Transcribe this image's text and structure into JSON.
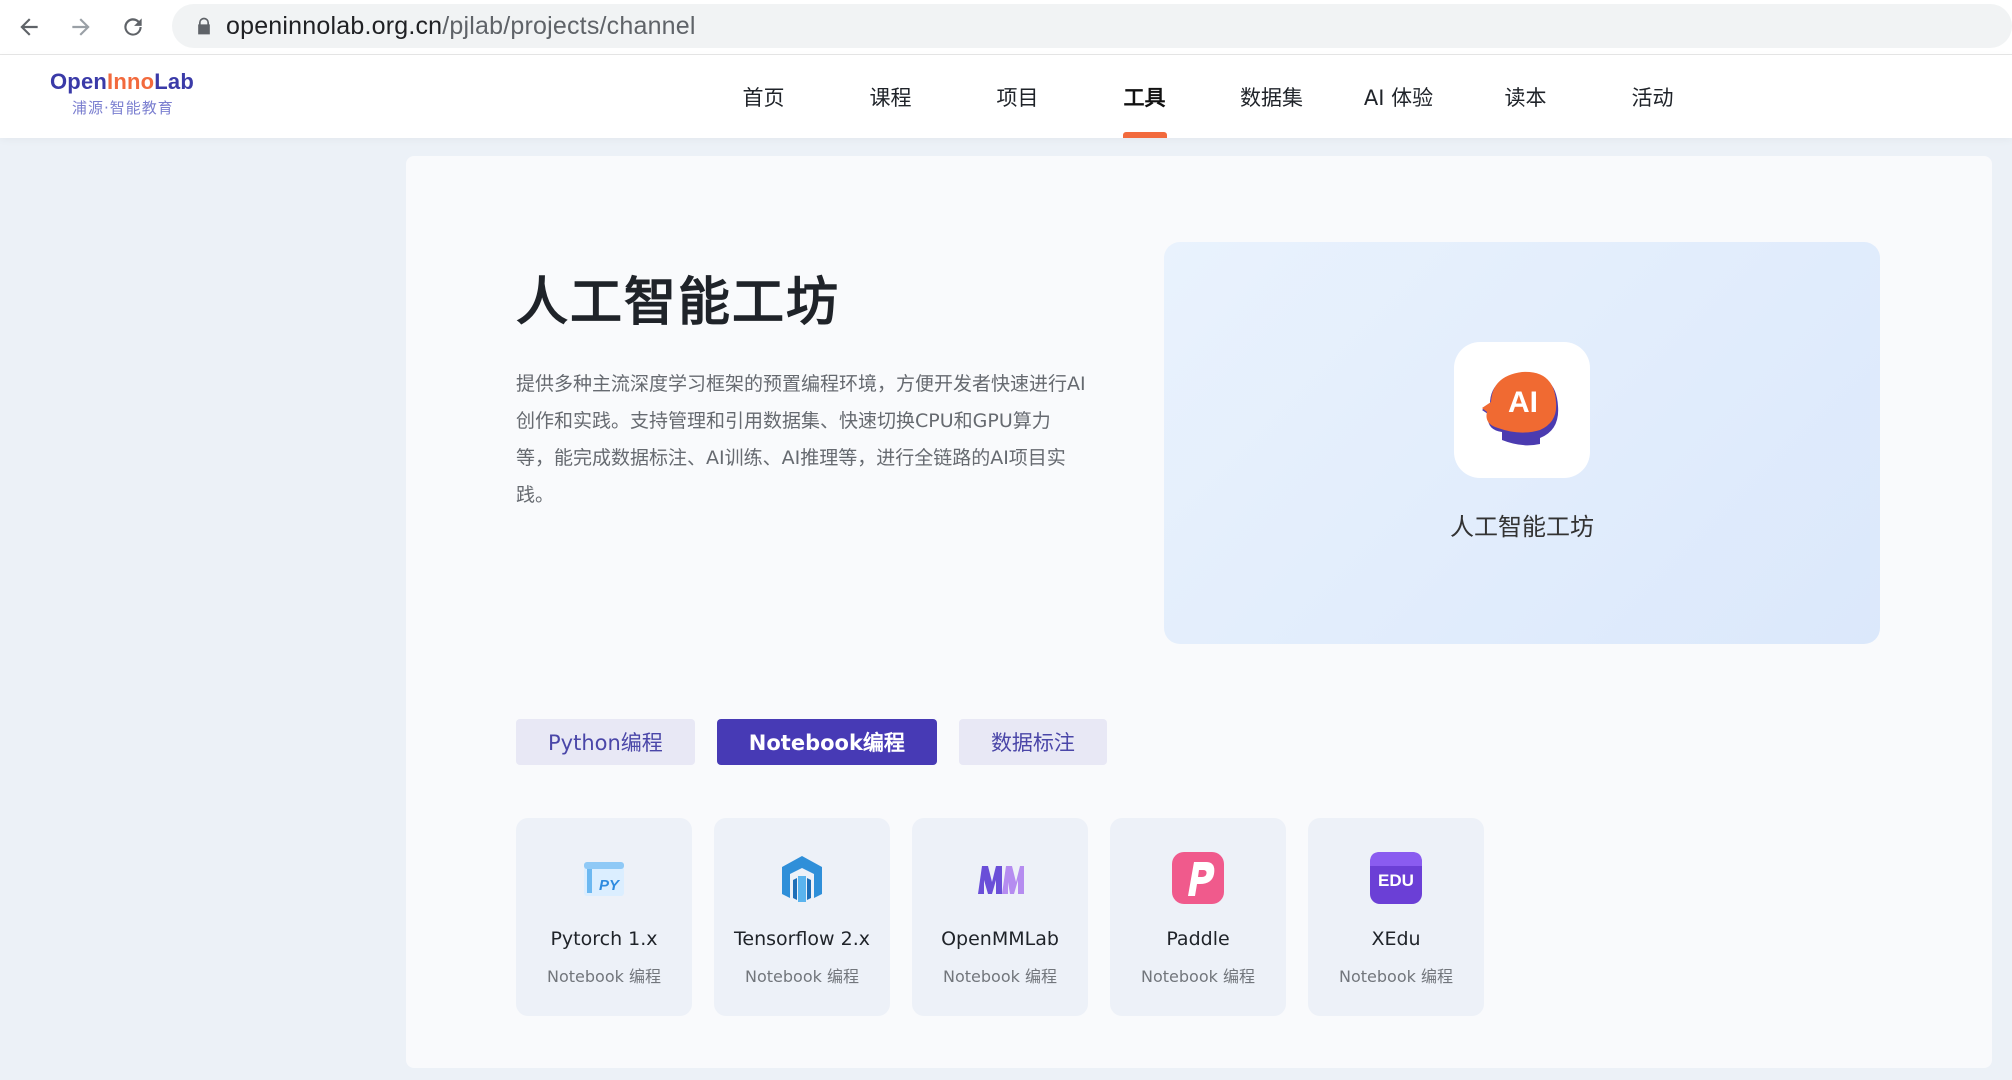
{
  "browser": {
    "url_host": "openinnolab.org.cn",
    "url_path": "/pjlab/projects/channel"
  },
  "header": {
    "logo_open": "Open",
    "logo_inno": "Inno",
    "logo_lab": "Lab",
    "logo_sub": "浦源·智能教育",
    "menu": [
      {
        "label": "首页"
      },
      {
        "label": "课程"
      },
      {
        "label": "项目"
      },
      {
        "label": "工具",
        "active": true
      },
      {
        "label": "数据集"
      },
      {
        "label": "AI 体验"
      },
      {
        "label": "读本"
      },
      {
        "label": "活动"
      }
    ]
  },
  "hero": {
    "title": "人工智能工坊",
    "description": "提供多种主流深度学习框架的预置编程环境，方便开发者快速进行AI创作和实践。支持管理和引用数据集、快速切换CPU和GPU算力等，能完成数据标注、AI训练、AI推理等，进行全链路的AI项目实践。",
    "card_label": "人工智能工坊",
    "card_icon_text": "AI"
  },
  "tabs": [
    {
      "label": "Python编程"
    },
    {
      "label": "Notebook编程",
      "active": true
    },
    {
      "label": "数据标注"
    }
  ],
  "tools": [
    {
      "name": "Pytorch 1.x",
      "sub": "Notebook 编程",
      "icon": "pytorch-icon"
    },
    {
      "name": "Tensorflow 2.x",
      "sub": "Notebook 编程",
      "icon": "tensorflow-icon"
    },
    {
      "name": "OpenMMLab",
      "sub": "Notebook 编程",
      "icon": "openmmlab-icon"
    },
    {
      "name": "Paddle",
      "sub": "Notebook 编程",
      "icon": "paddle-icon"
    },
    {
      "name": "XEdu",
      "sub": "Notebook 编程",
      "icon": "xedu-icon"
    }
  ],
  "colors": {
    "accent": "#f26a3d",
    "primary": "#473ab5"
  }
}
